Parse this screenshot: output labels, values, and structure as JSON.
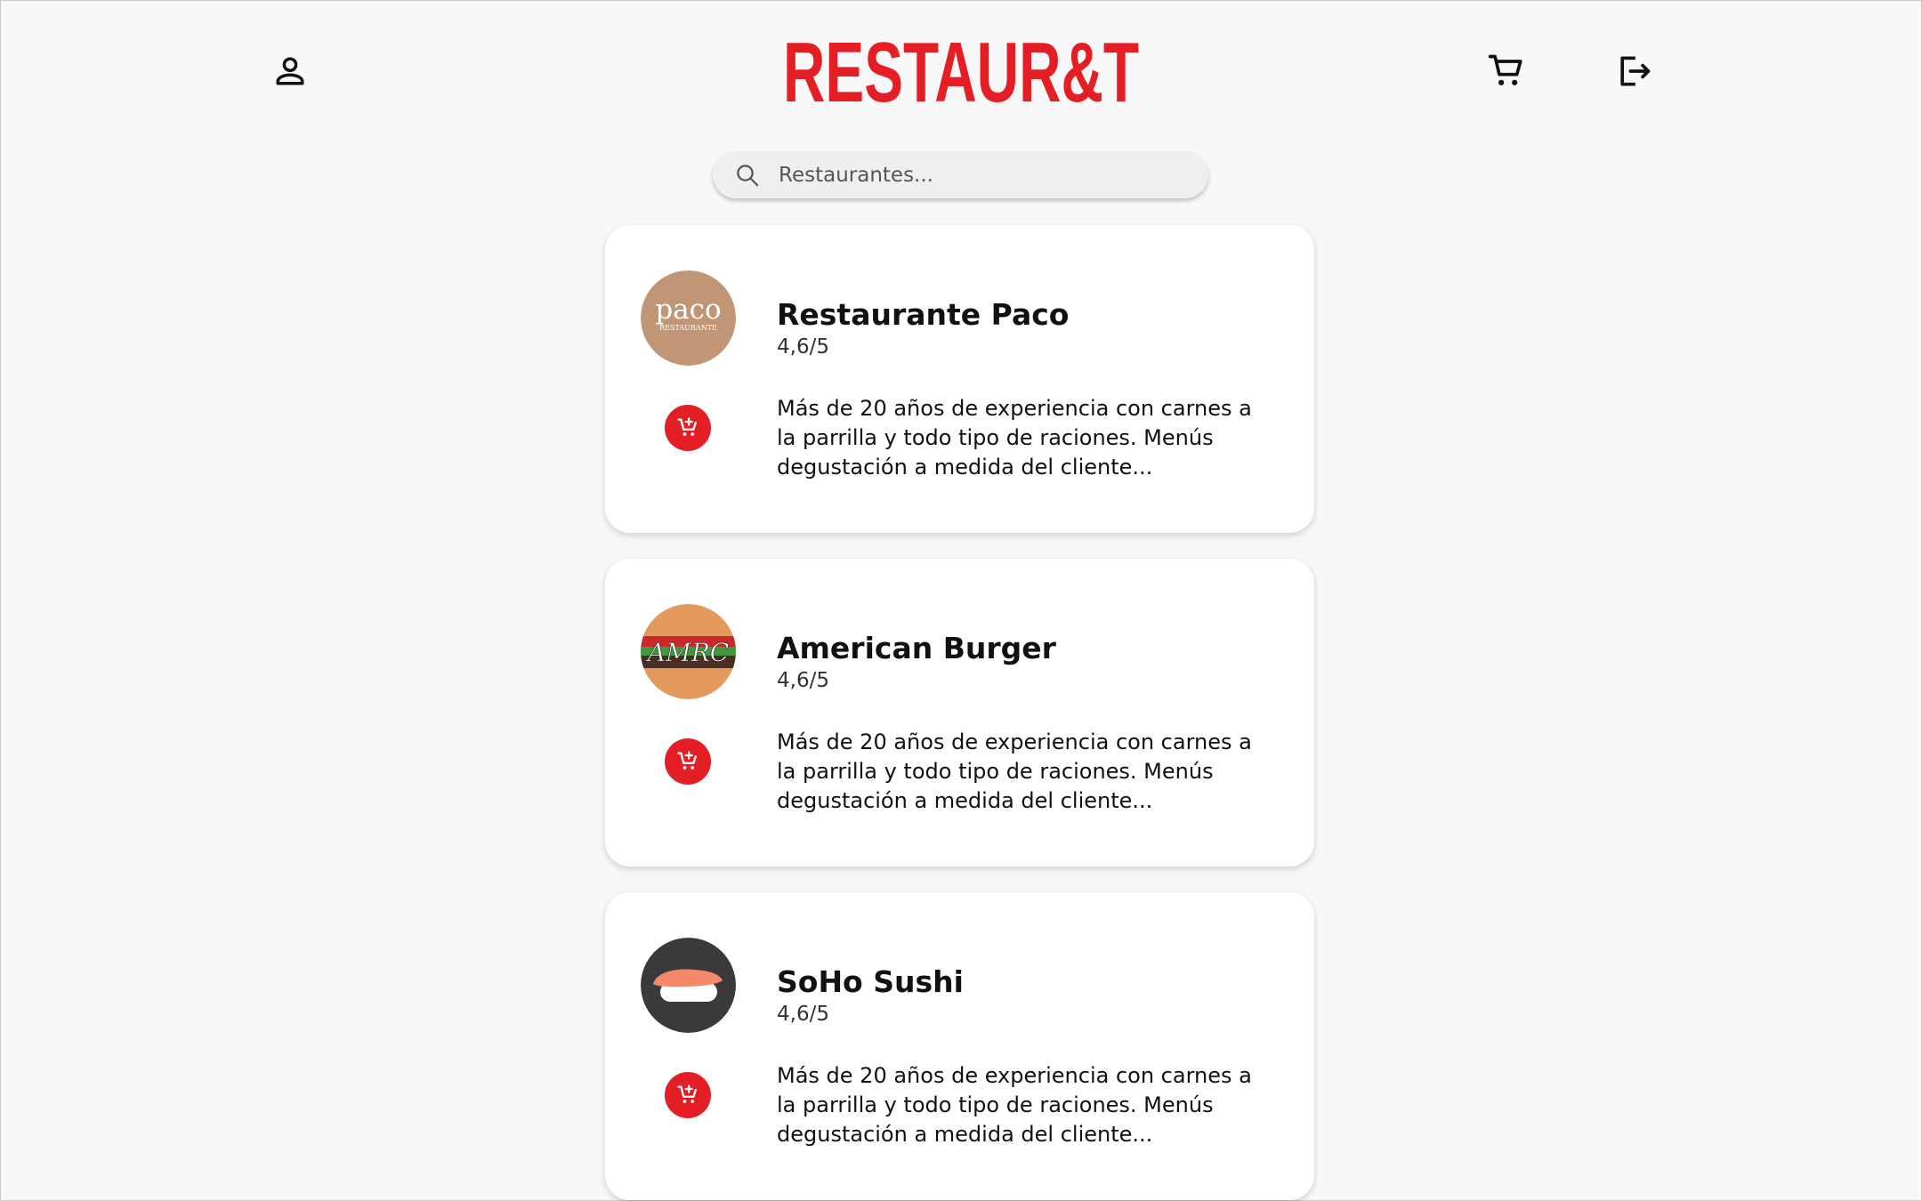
{
  "header": {
    "logo_text": "RESTAUR&T",
    "profile_icon": "person-icon",
    "cart_icon": "shopping-cart-icon",
    "logout_icon": "logout-icon"
  },
  "search": {
    "placeholder": "Restaurantes..."
  },
  "colors": {
    "brand_red": "#e31e24",
    "background": "#f8f8f8",
    "card": "#ffffff"
  },
  "restaurants": [
    {
      "name": "Restaurante Paco",
      "rating": "4,6/5",
      "description": "Más de 20 años de experiencia con carnes a la parrilla y todo tipo de raciones. Menús degustación a medida del cliente...",
      "logo_text": "paco",
      "logo_subtext": "RESTAURANTE"
    },
    {
      "name": "American Burger",
      "rating": "4,6/5",
      "description": "Más de 20 años de experiencia con carnes a la parrilla y todo tipo de raciones. Menús degustación a medida del cliente...",
      "logo_text": "AMRC"
    },
    {
      "name": "SoHo Sushi",
      "rating": "4,6/5",
      "description": "Más de 20 años de experiencia con carnes a la parrilla y todo tipo de raciones. Menús degustación a medida del cliente..."
    }
  ]
}
